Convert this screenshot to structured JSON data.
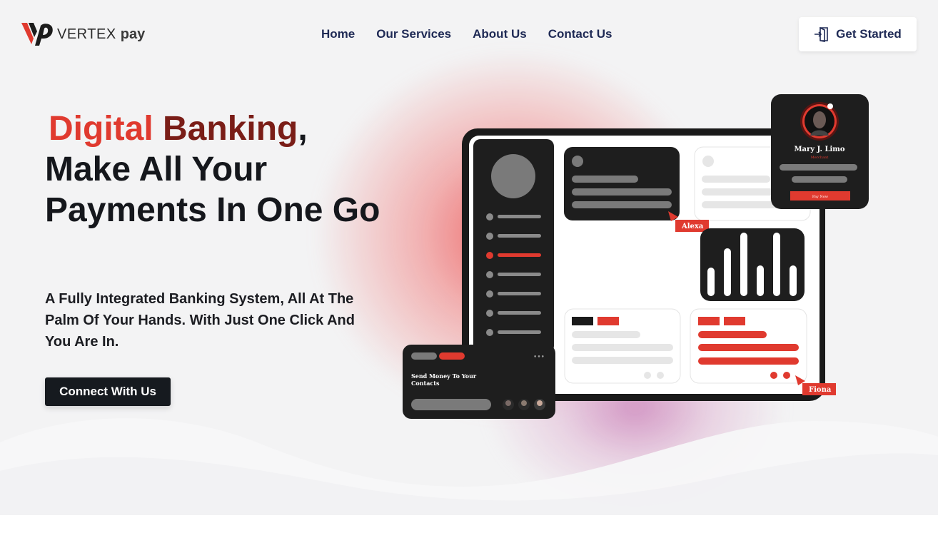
{
  "brand": {
    "logo_word": "VERTEX",
    "logo_suffix": "pay"
  },
  "nav": {
    "items": [
      "Home",
      "Our Services",
      "About Us",
      "Contact Us"
    ]
  },
  "header": {
    "cta_label": "Get Started",
    "cta_icon": "sign-in-icon"
  },
  "hero": {
    "title_accent_1": "Digital",
    "title_accent_2": "Banking",
    "title_comma": ",",
    "title_rest": "Make All Your Payments In One Go",
    "subtitle": "A Fully Integrated Banking System, All At The Palm Of Your Hands. With Just One Click And You Are In.",
    "cta_label": "Connect With Us"
  },
  "illustration": {
    "profile_name": "Mary J. Limo",
    "profile_role": "Merchant",
    "pay_button": "Pay Now",
    "tag_1": "Alexa",
    "tag_2": "Fiona",
    "send_money_line1": "Send Money To Your",
    "send_money_line2": "Contacts",
    "more_glyph": "•••"
  },
  "colors": {
    "accent_red": "#e03a2f",
    "dark_red": "#7a1d17",
    "navy": "#1f2a55",
    "dark": "#161a1f",
    "hero_bg": "#f3f3f4"
  }
}
